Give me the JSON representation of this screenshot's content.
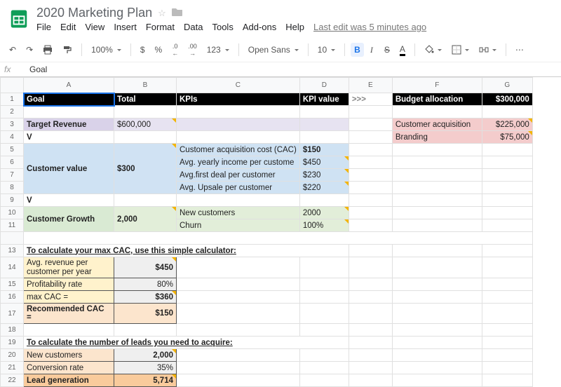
{
  "doc_title": "2020 Marketing Plan",
  "last_edit": "Last edit was 5 minutes ago",
  "menu": {
    "file": "File",
    "edit": "Edit",
    "view": "View",
    "insert": "Insert",
    "format": "Format",
    "data": "Data",
    "tools": "Tools",
    "addons": "Add-ons",
    "help": "Help"
  },
  "toolbar": {
    "zoom": "100%",
    "currency": "$",
    "percent": "%",
    "dec_dec": ".0",
    "dec_inc": ".00",
    "num_fmt": "123",
    "font": "Open Sans",
    "size": "10",
    "bold": "B",
    "italic": "I",
    "strike": "S",
    "text_color": "A"
  },
  "fx_value": "Goal",
  "headers": {
    "A": "Goal",
    "B": "Total",
    "C": "KPIs",
    "D": "KPI value",
    "E": ">>>",
    "F": "Budget allocation",
    "G": "$300,000"
  },
  "r3": {
    "A": "Target Revenue",
    "B": "$600,000",
    "F": "Customer acquisition",
    "G": "$225,000"
  },
  "r4": {
    "A": "V",
    "F": "Branding",
    "G": "$75,000"
  },
  "r5": {
    "C": "Customer acquisition cost (CAC)",
    "D": "$150"
  },
  "r6": {
    "A": "Customer value",
    "B": "$300",
    "C": "Avg. yearly income per custome",
    "D": "$450"
  },
  "r7": {
    "C": "Avg.first deal per customer",
    "D": "$230"
  },
  "r8": {
    "C": "Avg. Upsale per customer",
    "D": "$220"
  },
  "r9": {
    "A": "V"
  },
  "r10": {
    "A": "Customer Growth",
    "B": "2,000",
    "C": "New customers",
    "D": "2000"
  },
  "r11": {
    "C": "Churn",
    "D": "100%"
  },
  "r13": {
    "A": "To calculate your max CAC, use this simple calculator:"
  },
  "r14": {
    "A": "Avg. revenue per customer per year",
    "B": "$450"
  },
  "r15": {
    "A": "Profitability rate",
    "B": "80%"
  },
  "r16": {
    "A": "max CAC =",
    "B": "$360"
  },
  "r17": {
    "A": "Recommended CAC =",
    "B": "$150"
  },
  "r19": {
    "A": "To calculate the number of leads you need to acquire:"
  },
  "r20": {
    "A": "New customers",
    "B": "2,000"
  },
  "r21": {
    "A": "Conversion rate",
    "B": "35%"
  },
  "r22": {
    "A": "Lead generation",
    "B": "5,714"
  },
  "cols": [
    "A",
    "B",
    "C",
    "D",
    "E",
    "F",
    "G"
  ],
  "chart_data": null
}
